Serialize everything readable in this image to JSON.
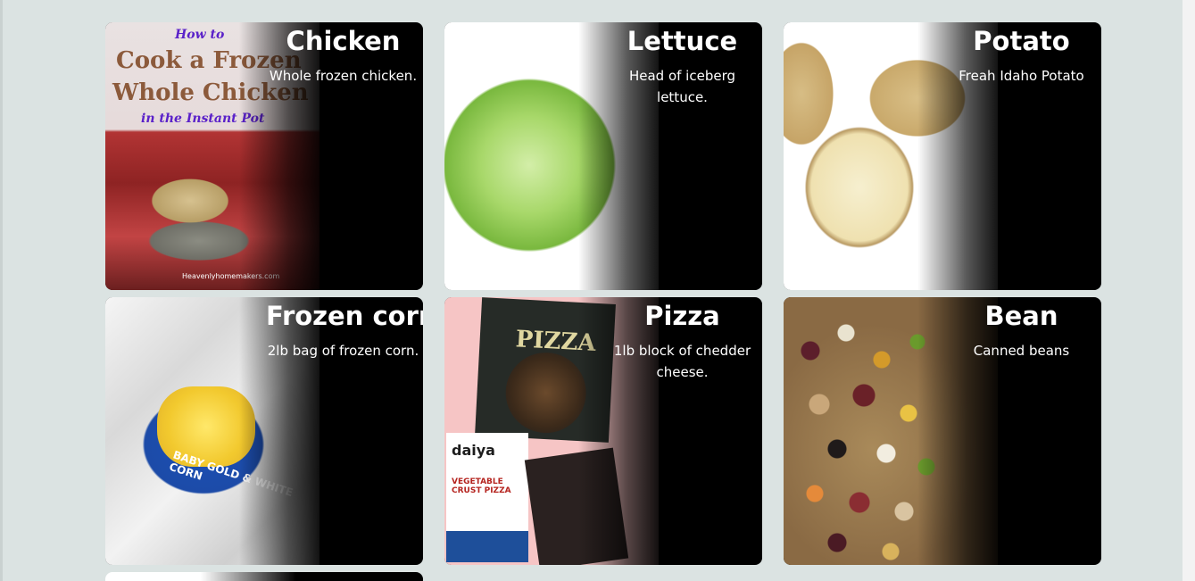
{
  "cards": [
    {
      "title": "Chicken",
      "description": "Whole frozen chicken.",
      "image_text": [
        "How to",
        "Cook a Frozen",
        "Whole Chicken",
        "in the Instant Pot",
        "Heavenlyhomemakers.com"
      ]
    },
    {
      "title": "Lettuce",
      "description": "Head of iceberg lettuce."
    },
    {
      "title": "Potato",
      "description": "Freah Idaho Potato"
    },
    {
      "title": "Frozen corn",
      "description": "2lb bag of frozen corn.",
      "image_text": [
        "BABY GOLD & WHITE CORN"
      ]
    },
    {
      "title": "Pizza",
      "description": "1lb block of chedder cheese.",
      "image_text": [
        "PIZZA",
        "daiya",
        "VEGETABLE CRUST PIZZA"
      ]
    },
    {
      "title": "Bean",
      "description": "Canned beans"
    }
  ]
}
